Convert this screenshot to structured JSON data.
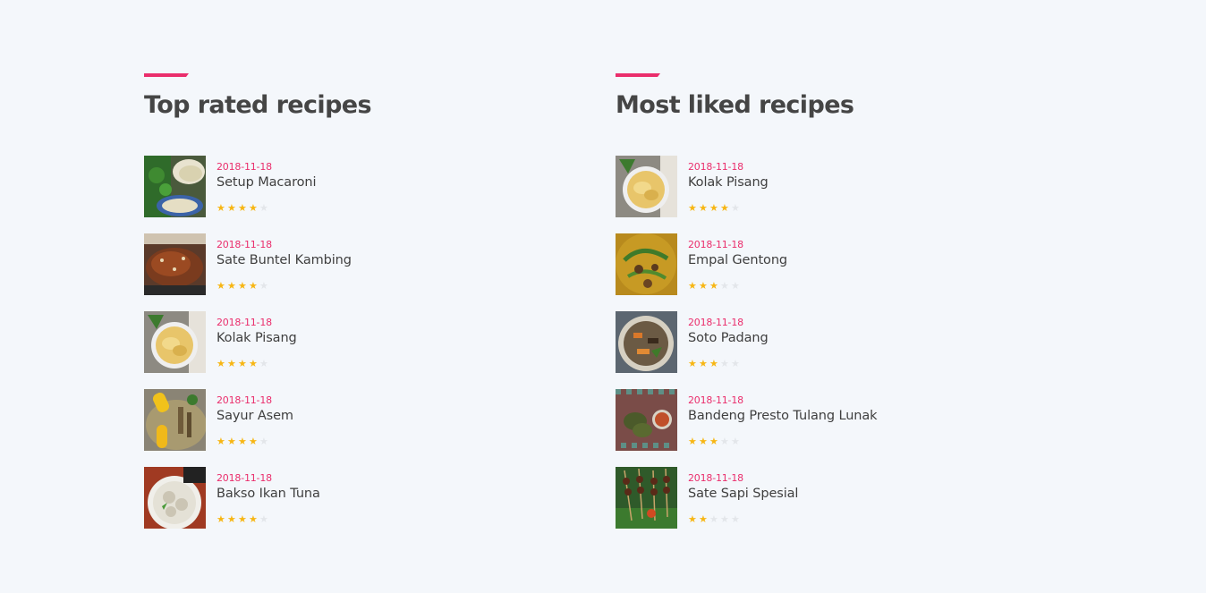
{
  "sections": [
    {
      "heading": "Top rated recipes",
      "items": [
        {
          "date": "2018-11-18",
          "title": "Setup Macaroni",
          "rating": 4,
          "image": "setup-macaroni-photo"
        },
        {
          "date": "2018-11-18",
          "title": "Sate Buntel Kambing",
          "rating": 4,
          "image": "sate-buntel-kambing-photo"
        },
        {
          "date": "2018-11-18",
          "title": "Kolak Pisang",
          "rating": 4,
          "image": "kolak-pisang-photo"
        },
        {
          "date": "2018-11-18",
          "title": "Sayur Asem",
          "rating": 4,
          "image": "sayur-asem-photo"
        },
        {
          "date": "2018-11-18",
          "title": "Bakso Ikan Tuna",
          "rating": 4,
          "image": "bakso-ikan-tuna-photo"
        }
      ]
    },
    {
      "heading": "Most liked recipes",
      "items": [
        {
          "date": "2018-11-18",
          "title": "Kolak Pisang",
          "rating": 4,
          "image": "kolak-pisang-photo"
        },
        {
          "date": "2018-11-18",
          "title": "Empal Gentong",
          "rating": 3,
          "image": "empal-gentong-photo"
        },
        {
          "date": "2018-11-18",
          "title": "Soto Padang",
          "rating": 3,
          "image": "soto-padang-photo"
        },
        {
          "date": "2018-11-18",
          "title": "Bandeng Presto Tulang Lunak",
          "rating": 3,
          "image": "bandeng-presto-photo"
        },
        {
          "date": "2018-11-18",
          "title": "Sate Sapi Spesial",
          "rating": 2,
          "image": "sate-sapi-photo"
        }
      ]
    }
  ],
  "rating_max": 5,
  "colors": {
    "accent": "#ea2e6c",
    "star_on": "#f7b614",
    "star_off": "#e3e6ea",
    "background": "#f4f7fb"
  }
}
